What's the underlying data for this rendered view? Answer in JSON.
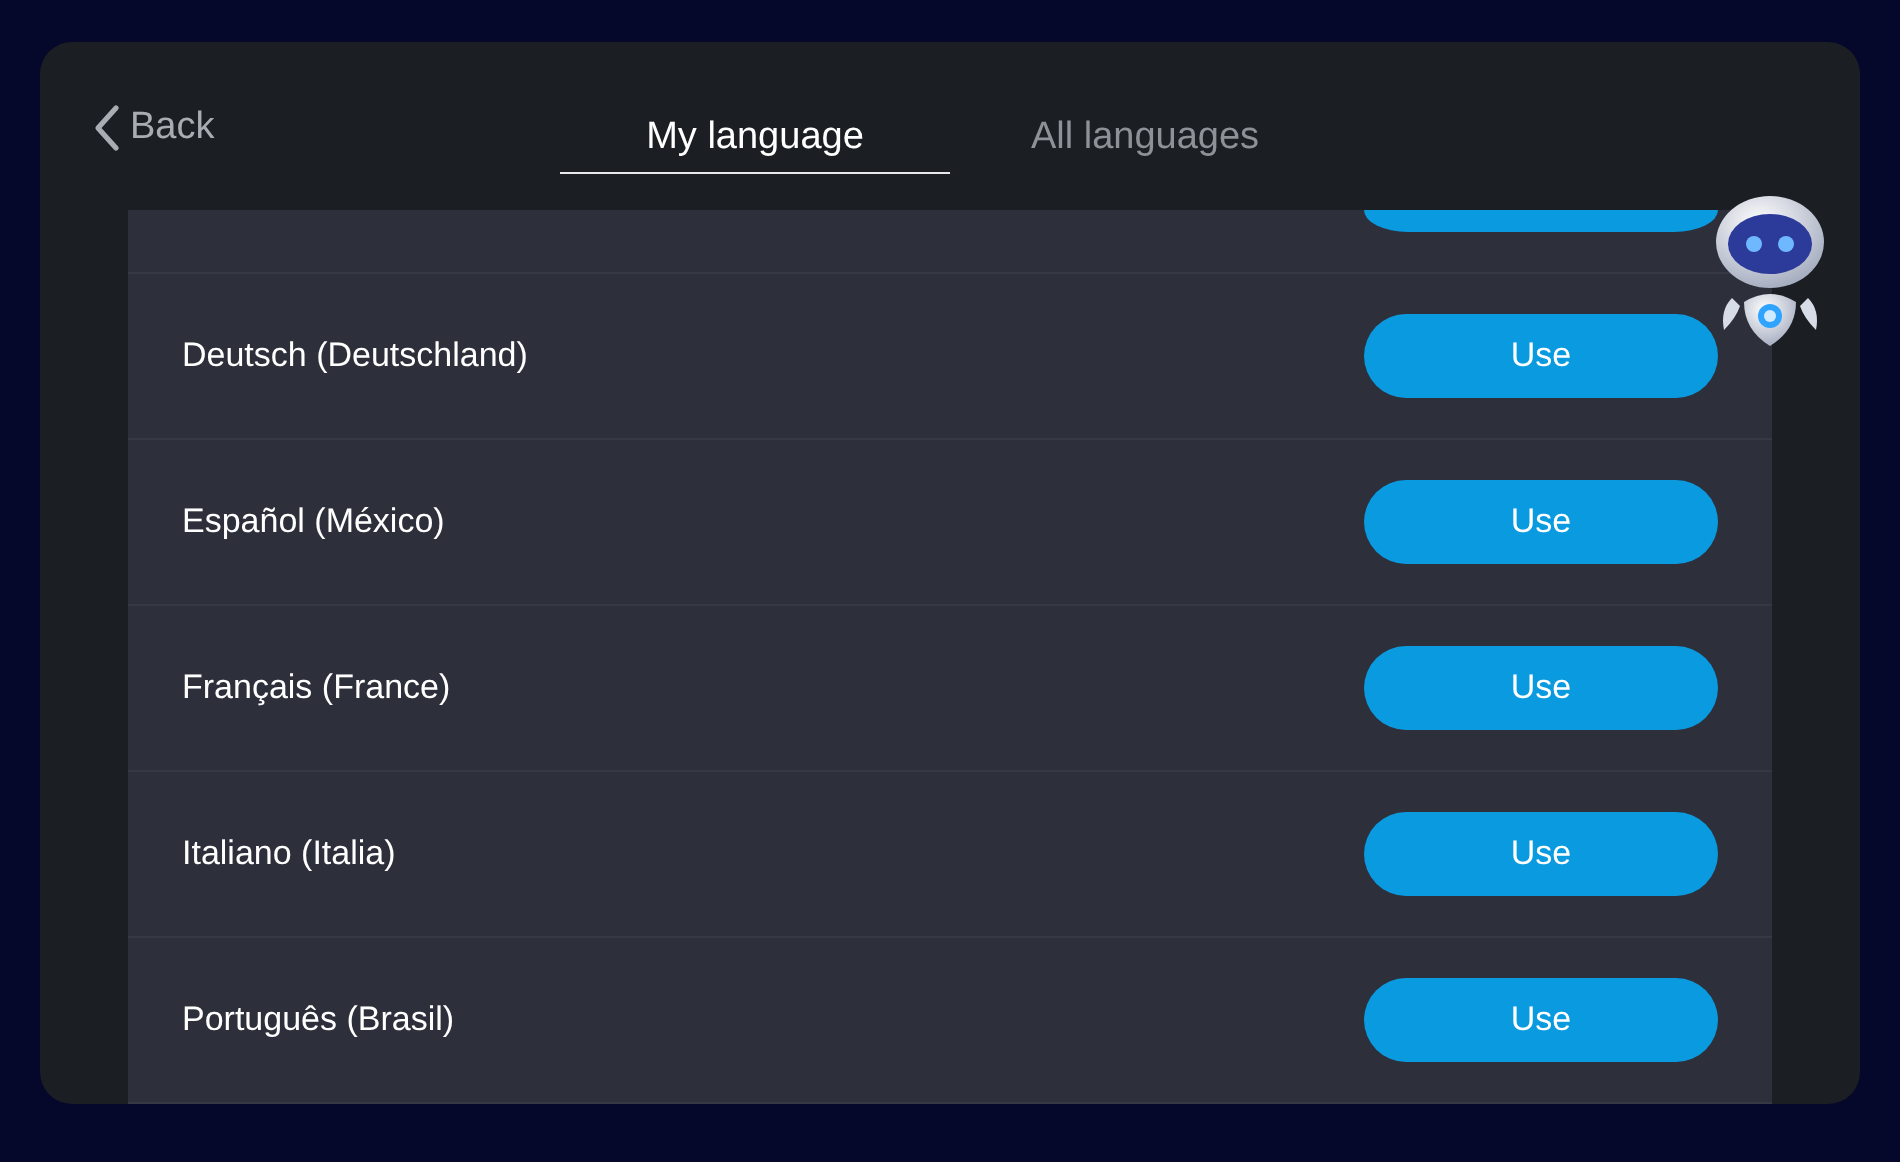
{
  "header": {
    "back": "Back",
    "tabs": [
      {
        "label": "My language",
        "selected": true
      },
      {
        "label": "All languages",
        "selected": false
      }
    ]
  },
  "languages": [
    {
      "name": "Deutsch (Deutschland)",
      "action": "Use"
    },
    {
      "name": "Español (México)",
      "action": "Use"
    },
    {
      "name": "Français (France)",
      "action": "Use"
    },
    {
      "name": "Italiano (Italia)",
      "action": "Use"
    },
    {
      "name": "Português (Brasil)",
      "action": "Use"
    }
  ]
}
